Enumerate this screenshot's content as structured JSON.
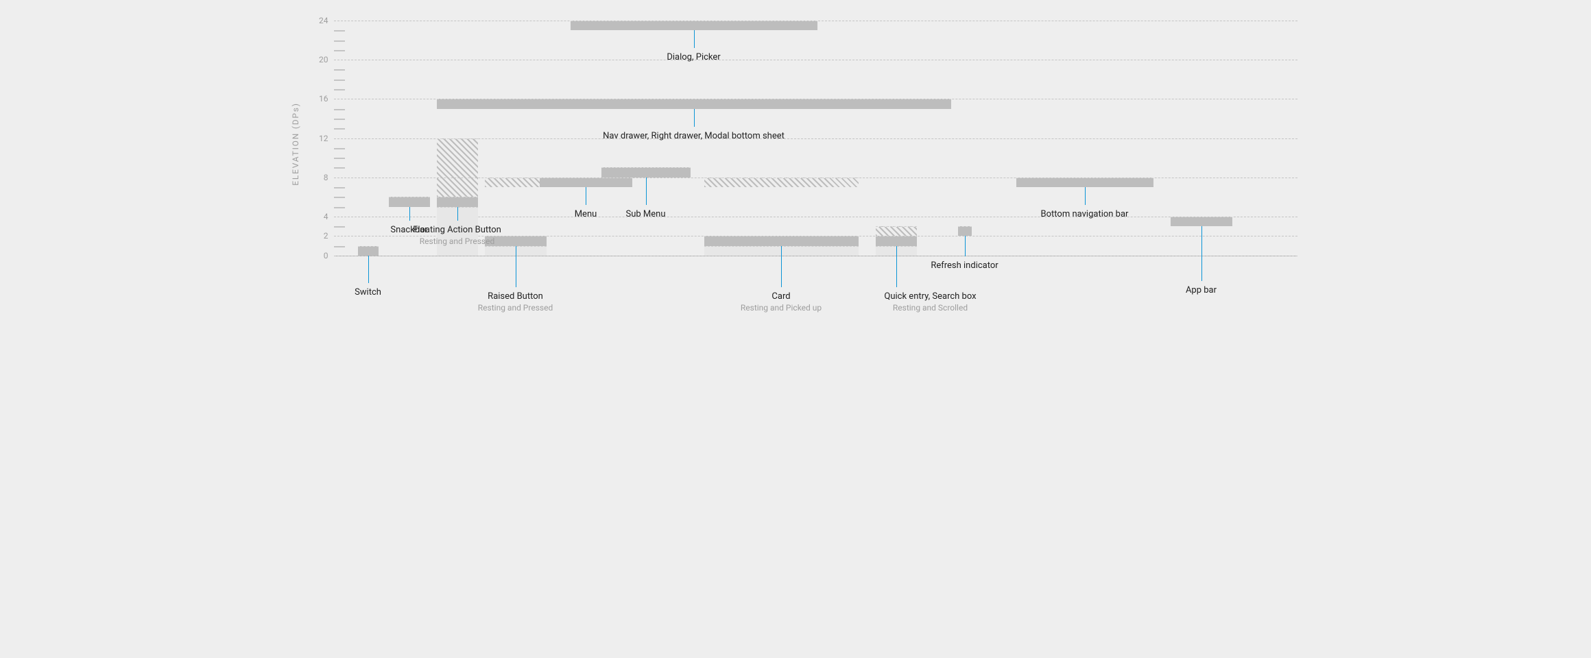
{
  "axis_title": "ELEVATION (DPs)",
  "y_ticks": [
    0,
    2,
    4,
    8,
    12,
    16,
    20,
    24
  ],
  "y_max": 24,
  "minor_tick_offsets": [
    1,
    2,
    3
  ],
  "labels": {
    "switch": "Switch",
    "snackbar": "Snackbar",
    "fab": "Floating Action Button",
    "fab_sub": "Resting and Pressed",
    "raised": "Raised Button",
    "raised_sub": "Resting and Pressed",
    "menu": "Menu",
    "submenu": "Sub Menu",
    "dialog": "Dialog, Picker",
    "drawer": "Nav drawer, Right drawer, Modal bottom sheet",
    "card": "Card",
    "card_sub": "Resting and Picked up",
    "search": "Quick entry, Search box",
    "search_sub": "Resting and Scrolled",
    "refresh": "Refresh indicator",
    "bnav": "Bottom navigation bar",
    "appbar": "App bar"
  },
  "chart_data": {
    "type": "bar",
    "xlabel": "",
    "ylabel": "ELEVATION (DPs)",
    "ylim": [
      0,
      24
    ],
    "yticks": [
      0,
      2,
      4,
      8,
      12,
      16,
      20,
      24
    ],
    "title": "",
    "series_note": "Each item is a Material Design component. 'range' is the elevation band shown in solid grey. 'light' is a lighter band shown beneath the solid band (typically a resting→raised span). 'hatch' is a diagonally-hatched band shown above (a dynamic / pressed or scrolled state).",
    "items": [
      {
        "name": "Switch",
        "range": [
          0,
          1
        ]
      },
      {
        "name": "Snackbar",
        "range": [
          5,
          6
        ]
      },
      {
        "name": "Floating Action Button",
        "range": [
          5,
          6
        ],
        "light": [
          0,
          5
        ],
        "hatch": [
          6,
          12
        ],
        "subtitle": "Resting and Pressed"
      },
      {
        "name": "Raised Button",
        "range": [
          1,
          2
        ],
        "light": [
          0,
          1
        ],
        "hatch": [
          7,
          8
        ],
        "subtitle": "Resting and Pressed"
      },
      {
        "name": "Menu",
        "range": [
          7,
          8
        ]
      },
      {
        "name": "Sub Menu",
        "range": [
          8,
          9
        ]
      },
      {
        "name": "Dialog, Picker",
        "range": [
          23,
          24
        ]
      },
      {
        "name": "Nav drawer, Right drawer, Modal bottom sheet",
        "range": [
          15,
          16
        ]
      },
      {
        "name": "Card",
        "range": [
          1,
          2
        ],
        "light": [
          0,
          1
        ],
        "hatch": [
          7,
          8
        ],
        "subtitle": "Resting and Picked up"
      },
      {
        "name": "Quick entry, Search box",
        "range": [
          1,
          2
        ],
        "light": [
          0,
          1
        ],
        "hatch": [
          2,
          3
        ],
        "subtitle": "Resting and Scrolled"
      },
      {
        "name": "Refresh indicator",
        "range": [
          2,
          3
        ]
      },
      {
        "name": "Bottom navigation bar",
        "range": [
          7,
          8
        ]
      },
      {
        "name": "App bar",
        "range": [
          3,
          4
        ]
      }
    ]
  }
}
